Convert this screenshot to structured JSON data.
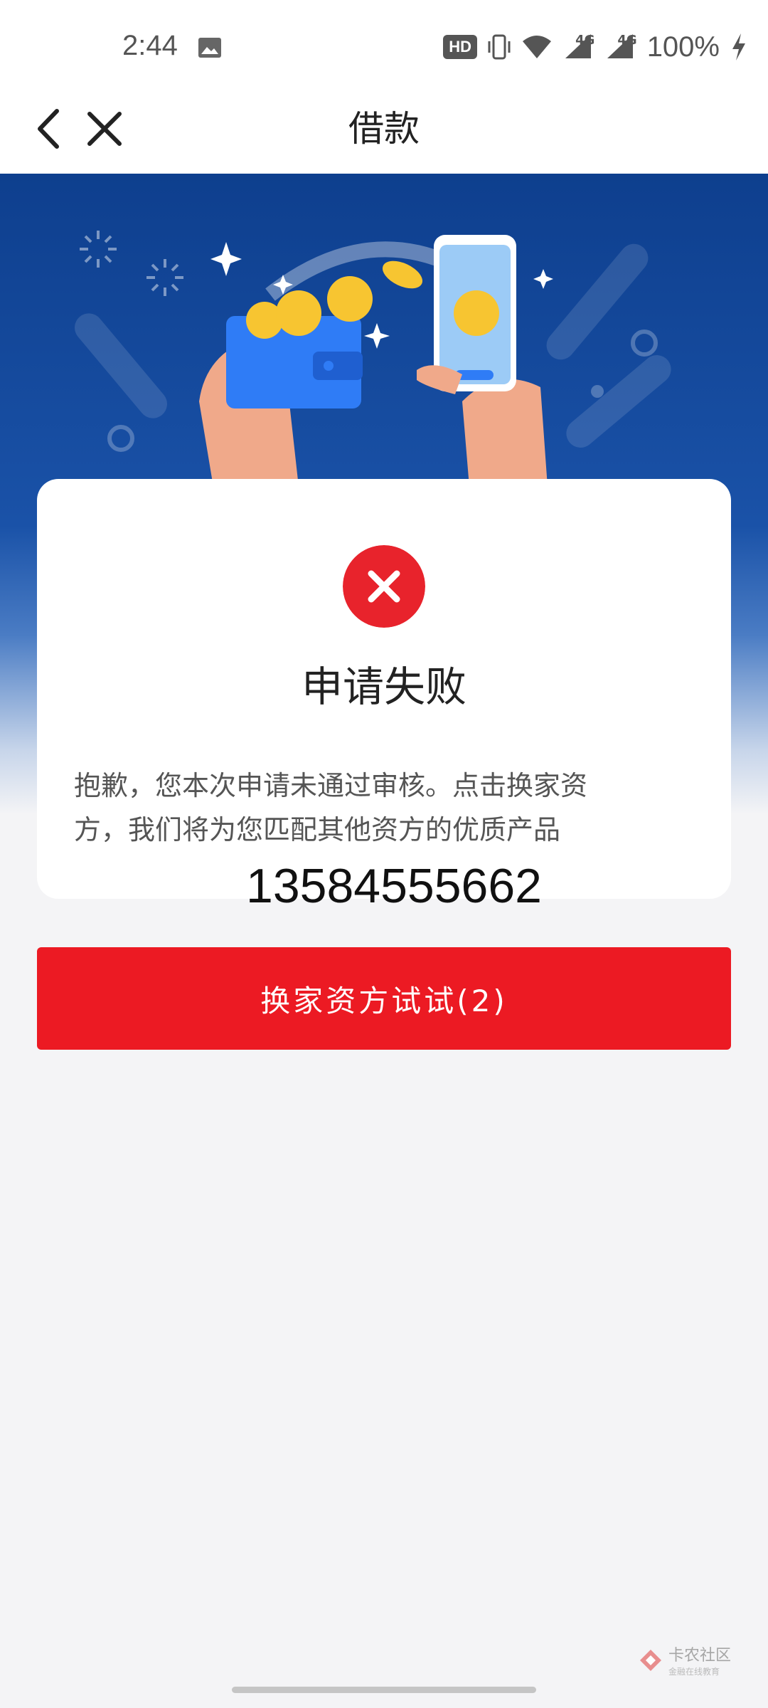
{
  "status_bar": {
    "time": "2:44",
    "hd_badge": "HD",
    "network_1": "4G",
    "network_2": "4G",
    "battery": "100%"
  },
  "nav": {
    "title": "借款",
    "back_icon": "chevron-left-icon",
    "close_icon": "close-icon"
  },
  "result_card": {
    "status_icon": "error-x-icon",
    "title": "申请失败",
    "message_line1": "抱歉，您本次申请未通过审核。点击换家资",
    "message_line2": "方，我们将为您匹配其他资方的优质产品",
    "phone_number": "13584555662"
  },
  "action": {
    "button_label": "换家资方试试(2)"
  },
  "watermark": {
    "brand": "卡农社区",
    "subtitle": "金融在线教育"
  },
  "colors": {
    "accent_red": "#ec1a23",
    "hero_blue": "#1a52a8"
  }
}
